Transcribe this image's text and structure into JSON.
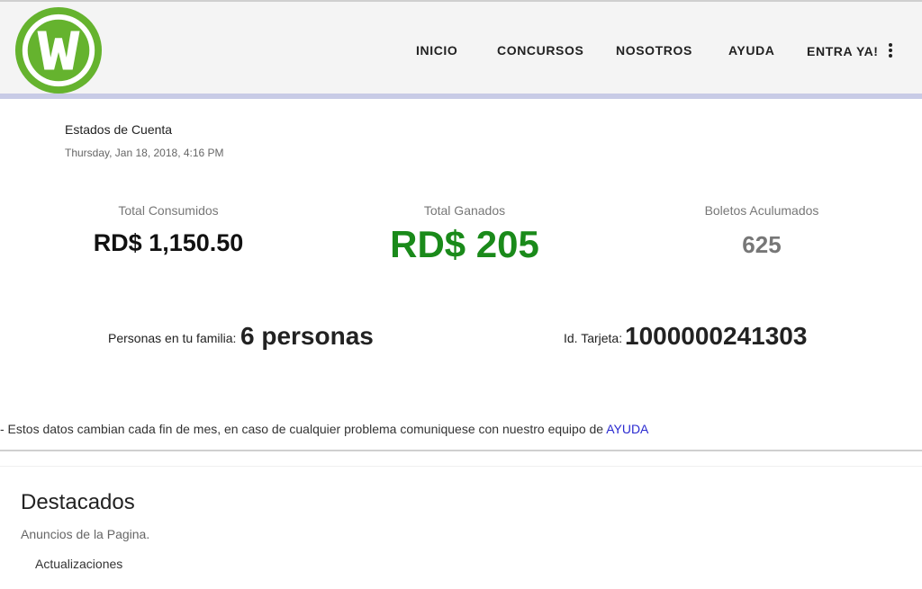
{
  "header": {
    "logo_icon": "wolfsburg-w-logo-icon",
    "brand_color": "#65b32e",
    "nav": {
      "inicio": "INICIO",
      "concursos": "CONCURSOS",
      "nosotros": "NOSOTROS",
      "ayuda": "AYUDA",
      "entra": "ENTRA YA!"
    },
    "menu_icon": "vertical-dots-icon"
  },
  "account": {
    "title": "Estados de Cuenta",
    "date": "Thursday, Jan 18, 2018, 4:16 PM",
    "stats": {
      "consumidos_label": "Total Consumidos",
      "consumidos_value": "RD$ 1,150.50",
      "ganados_label": "Total Ganados",
      "ganados_value": "RD$ 205",
      "ganados_color": "#1a8a1a",
      "boletos_label": "Boletos Aculumados",
      "boletos_value": "625"
    },
    "familia_label": "Personas en tu familia:",
    "familia_value": "6 personas",
    "tarjeta_label": "Id. Tarjeta:",
    "tarjeta_value": "1000000241303",
    "notice_text": "- Estos datos cambian cada fin de mes, en caso de cualquier problema comuniquese con nuestro equipo de ",
    "notice_link": "AYUDA"
  },
  "destacados": {
    "title": "Destacados",
    "subtitle": "Anuncios de la Pagina.",
    "item": "Actualizaciones"
  }
}
